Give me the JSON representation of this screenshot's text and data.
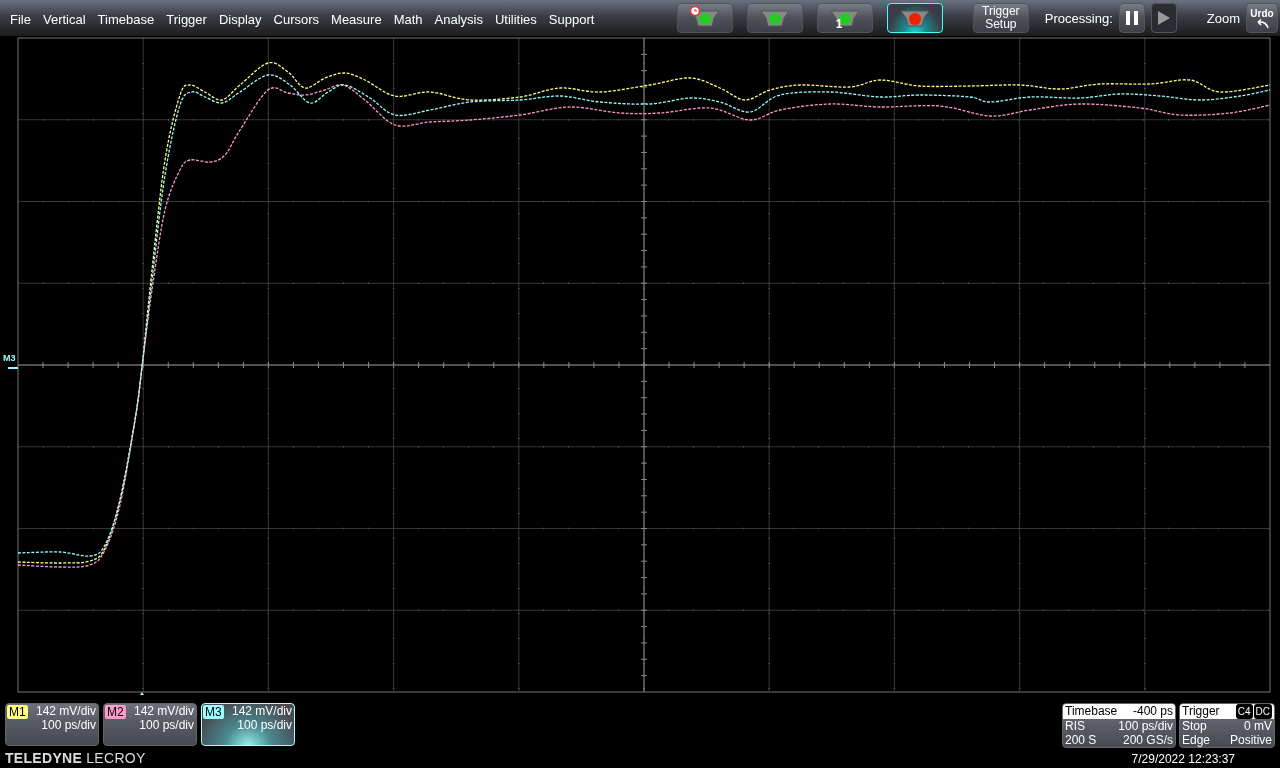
{
  "menu": [
    "File",
    "Vertical",
    "Timebase",
    "Trigger",
    "Display",
    "Cursors",
    "Measure",
    "Math",
    "Analysis",
    "Utilities",
    "Support"
  ],
  "trigger_buttons": [
    {
      "kind": "timer",
      "color": "#22cc22",
      "selected": false
    },
    {
      "kind": "plain",
      "color": "#22cc22",
      "selected": false
    },
    {
      "kind": "count",
      "text": "1",
      "color": "#22cc22",
      "selected": false
    },
    {
      "kind": "plain",
      "color": "#ee2200",
      "selected": true
    }
  ],
  "trigger_setup": "Trigger Setup",
  "processing": {
    "label": "Processing:"
  },
  "zoom": "Zoom",
  "undo": "Urdo",
  "plot": {
    "marker": "M3",
    "traces": [
      {
        "color": "#ffff80"
      },
      {
        "color": "#ff99cc"
      },
      {
        "color": "#99ffff"
      }
    ]
  },
  "channels": [
    {
      "label": "M1",
      "color": "#ffff80",
      "vdiv": "142 mV/div",
      "tdiv": "100 ps/div",
      "selected": false
    },
    {
      "label": "M2",
      "color": "#ff99cc",
      "vdiv": "142 mV/div",
      "tdiv": "100 ps/div",
      "selected": false
    },
    {
      "label": "M3",
      "color": "#99ffff",
      "vdiv": "142 mV/div",
      "tdiv": "100 ps/div",
      "selected": true
    }
  ],
  "logo": {
    "bold": "TELEDYNE",
    "light": "LECROY"
  },
  "timebase": {
    "title": "Timebase",
    "delay": "-400 ps",
    "rows": [
      [
        "RIS",
        "100 ps/div"
      ],
      [
        "200 S",
        "200 GS/s"
      ]
    ]
  },
  "trigger": {
    "title": "Trigger",
    "badges": [
      "C4",
      "DC"
    ],
    "rows": [
      [
        "Stop",
        "0 mV"
      ],
      [
        "Edge",
        "Positive"
      ]
    ]
  },
  "datetime": "7/29/2022 12:23:37"
}
